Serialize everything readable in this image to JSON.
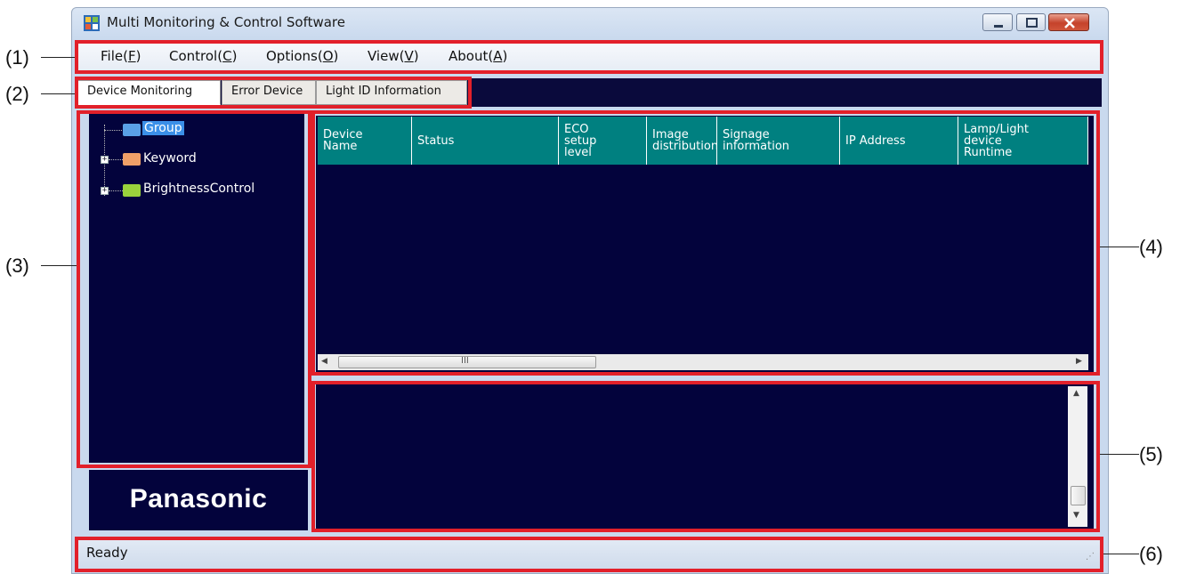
{
  "window": {
    "title": "Multi Monitoring & Control Software",
    "icon": "app-grid-icon"
  },
  "menu": {
    "items": [
      {
        "label": "File(",
        "key": "F",
        "suffix": ")"
      },
      {
        "label": "Control(",
        "key": "C",
        "suffix": ")"
      },
      {
        "label": "Options(",
        "key": "O",
        "suffix": ")"
      },
      {
        "label": "View(",
        "key": "V",
        "suffix": ")"
      },
      {
        "label": "About(",
        "key": "A",
        "suffix": ")"
      }
    ]
  },
  "tabs": [
    {
      "label": "Device Monitoring",
      "selected": true
    },
    {
      "label": "Error Device",
      "selected": false
    },
    {
      "label": "Light ID Information",
      "selected": false
    }
  ],
  "tree": {
    "nodes": [
      {
        "label": "Group",
        "selected": true,
        "expander": "",
        "folder_color": "#5aa0e6"
      },
      {
        "label": "Keyword",
        "selected": false,
        "expander": "+",
        "folder_color": "#f0a068"
      },
      {
        "label": "BrightnessControl",
        "selected": false,
        "expander": "+",
        "folder_color": "#9ad23c"
      }
    ]
  },
  "grid": {
    "columns": [
      "Device\nName",
      "Status",
      "ECO\nsetup\nlevel",
      "Image\ndistribution",
      "Signage\ninformation",
      "IP Address",
      "Lamp/Light\ndevice\nRuntime"
    ],
    "scroll_grip": "III",
    "header_color": "#008080"
  },
  "logo": "Panasonic",
  "status": {
    "text": "Ready"
  },
  "callouts": [
    "(1)",
    "(2)",
    "(3)",
    "(4)",
    "(5)",
    "(6)"
  ],
  "colors": {
    "highlight": "#e2202a",
    "panel_bg": "#03033c"
  }
}
